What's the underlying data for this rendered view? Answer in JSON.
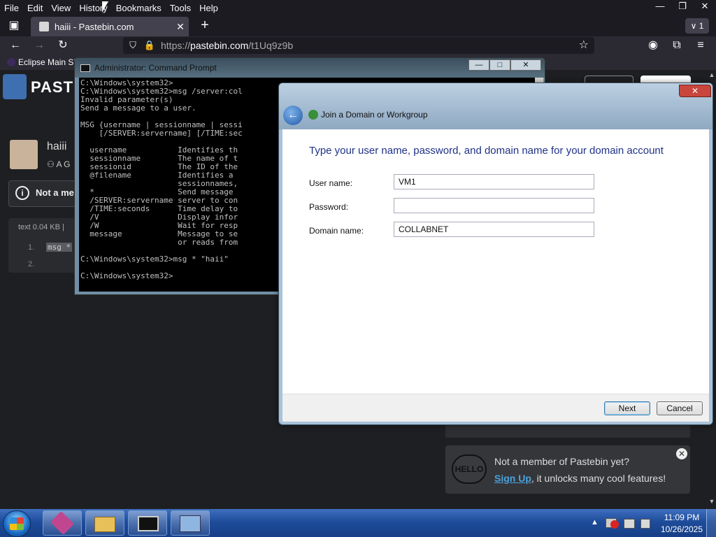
{
  "browser": {
    "menu": [
      "File",
      "Edit",
      "View",
      "History",
      "Bookmarks",
      "Tools",
      "Help"
    ],
    "window_controls": {
      "minimize": "—",
      "restore": "❐",
      "close": "✕"
    },
    "tab": {
      "title": "haiii - Pastebin.com",
      "close": "✕"
    },
    "new_tab": "+",
    "tab_list": "∨ 1",
    "url": {
      "prefix": "https://",
      "host": "pastebin.com",
      "path": "/t1Uq9z9b"
    },
    "bookmark": "Eclipse Main Si"
  },
  "pastebin": {
    "logo_text": "PAST",
    "paste_title": "haiii",
    "author": "A G",
    "notice": "Not a me",
    "meta": "text  0.04 KB  |",
    "line_numbers": [
      "1.",
      "2."
    ],
    "code_line1": "msg *",
    "signup": {
      "badge": "HELLO",
      "line1": "Not a member of Pastebin yet?",
      "link": "Sign Up",
      "line2": ", it unlocks many cool features!",
      "close": "✕"
    }
  },
  "cmd": {
    "title": "Administrator: Command Prompt",
    "buttons": {
      "minimize": "—",
      "maximize": "□",
      "close": "✕"
    },
    "lines": [
      "C:\\Windows\\system32>",
      "C:\\Windows\\system32>msg /server:col",
      "Invalid parameter(s)",
      "Send a message to a user.",
      "",
      "MSG {username | sessionname | sessi",
      "    [/SERVER:servername] [/TIME:sec",
      "",
      "  username           Identifies th",
      "  sessionname        The name of t",
      "  sessionid          The ID of the",
      "  @filename          Identifies a ",
      "                     sessionnames,",
      "  *                  Send message ",
      "  /SERVER:servername server to con",
      "  /TIME:seconds      Time delay to",
      "  /V                 Display infor",
      "  /W                 Wait for resp",
      "  message            Message to se",
      "                     or reads from",
      "",
      "C:\\Windows\\system32>msg * \"haii\"",
      "",
      "C:\\Windows\\system32>"
    ]
  },
  "dialog": {
    "title": "Join a Domain or Workgroup",
    "close": "✕",
    "heading": "Type your user name, password, and domain name for your domain account",
    "fields": {
      "username_label": "User name:",
      "username_value": "VM1",
      "password_label": "Password:",
      "password_value": "",
      "domain_label": "Domain name:",
      "domain_value": "COLLABNET"
    },
    "buttons": {
      "next": "Next",
      "cancel": "Cancel"
    }
  },
  "taskbar": {
    "clock_time": "11:09 PM",
    "clock_date": "10/26/2025",
    "tray_arrow": "▲"
  }
}
